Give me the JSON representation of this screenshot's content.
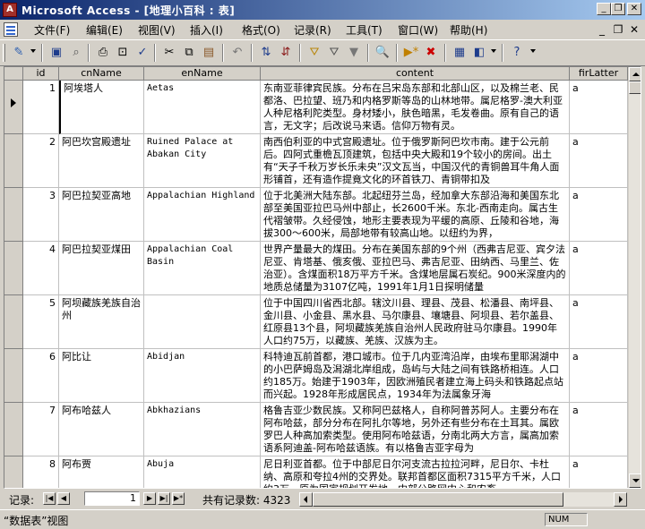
{
  "window": {
    "title": "Microsoft Access - [地理小百科 : 表]",
    "app_icon": "access-key-icon"
  },
  "menu": [
    "文件(F)",
    "编辑(E)",
    "视图(V)",
    "插入(I)",
    "格式(O)",
    "记录(R)",
    "工具(T)",
    "窗口(W)",
    "帮助(H)"
  ],
  "mdi_controls": [
    "minimize",
    "restore",
    "close"
  ],
  "toolbar_icons": [
    "view-icon",
    "save-icon",
    "search-db-icon",
    "print-icon",
    "print-preview-icon",
    "spelling-icon",
    "cut-icon",
    "copy-icon",
    "paste-icon",
    "undo-icon",
    "sort-asc-icon",
    "sort-desc-icon",
    "filter-selection-icon",
    "filter-form-icon",
    "apply-filter-icon",
    "find-icon",
    "new-record-icon",
    "delete-record-icon",
    "database-window-icon",
    "new-object-icon",
    "help-icon"
  ],
  "table": {
    "columns": [
      "id",
      "cnName",
      "enName",
      "content",
      "firLatter"
    ],
    "rows": [
      {
        "id": "1",
        "cnName": "阿埃塔人",
        "enName": "Aetas",
        "content": "东南亚菲律宾民族。分布在吕宋岛东部和北部山区，以及棉兰老、民都洛、巴拉望、班乃和内格罗斯等岛的山林地带。属尼格罗-澳大利亚人种尼格利陀类型。身材矮小，肤色暗黑，毛发卷曲。原有自己的语言，无文字；后改说马来语。信仰万物有灵。",
        "firLatter": "a"
      },
      {
        "id": "2",
        "cnName": "阿巴坎宫殿遗址",
        "enName": "Ruined Palace at Abakan City",
        "content": "南西伯利亚的中式宫殿遗址。位于俄罗斯阿巴坎市南。建于公元前后。四阿式重檐瓦顶建筑，包括中央大殿和19个较小的房间。出土有“天子千秋万岁长乐未央”汉文瓦当，中国汉代的青铜兽耳牛角人面形铺首，还有造作提竟文化的环首铁刀、青铜带扣及",
        "firLatter": "a"
      },
      {
        "id": "3",
        "cnName": "阿巴拉契亚高地",
        "enName": "Appalachian Highland",
        "content": "位于北美洲大陆东部。北起纽芬兰岛，经加拿大东部沿海和美国东北部至美国亚拉巴马州中部止，长2600千米。东北-西南走向。属古生代褶皱带。久经侵蚀，地形主要表现为平缓的高原、丘陵和谷地，海拔300～600米，局部地带有较高山地。以纽约为界，",
        "firLatter": "a"
      },
      {
        "id": "4",
        "cnName": "阿巴拉契亚煤田",
        "enName": "Appalachian Coal Basin",
        "content": "世界产量最大的煤田。分布在美国东部的9个州（西弗吉尼亚、宾夕法尼亚、肯塔基、俄亥俄、亚拉巴马、弗吉尼亚、田纳西、马里兰、佐治亚）。含煤面积18万平方千米。含煤地层属石炭纪。900米深度内的地质总储量为3107亿吨，1991年1月1日探明储量",
        "firLatter": "a"
      },
      {
        "id": "5",
        "cnName": "阿坝藏族羌族自治州",
        "enName": "",
        "content": "位于中国四川省西北部。辖汶川县、理县、茂县、松潘县、南坪县、金川县、小金县、黑水县、马尔康县、壤塘县、阿坝县、若尔盖县、红原县13个县，阿坝藏族羌族自治州人民政府驻马尔康县。1990年人口约75万，以藏族、羌族、汉族为主。",
        "firLatter": "a"
      },
      {
        "id": "6",
        "cnName": "阿比让",
        "enName": "Abidjan",
        "content": "科特迪瓦前首都，港口城市。位于几内亚湾沿岸，由埃布里耶潟湖中的小巴萨姆岛及潟湖北岸组成，岛屿与大陆之间有铁路桥相连。人口约185万。始建于1903年，因欧洲殖民者建立海上码头和铁路起点站而兴起。1928年形成居民点，1934年为法属象牙海",
        "firLatter": "a"
      },
      {
        "id": "7",
        "cnName": "阿布哈兹人",
        "enName": "Abkhazians",
        "content": "格鲁吉亚少数民族。又称阿巴兹格人，自称阿普苏阿人。主要分布在阿布哈兹，部分分布在阿扎尔等地，另外还有些分布在土耳其。属欧罗巴人种高加索类型。使用阿布哈兹语，分南北两大方言，属高加索语系阿迪盖-阿布哈兹语族。有以格鲁吉亚字母为",
        "firLatter": "a"
      },
      {
        "id": "8",
        "cnName": "阿布贾",
        "enName": "Abuja",
        "content": "尼日利亚首都。位于中部尼日尔河支流古拉拉河畔，尼日尔、卡杜纳、高原和夸拉4州的交界处。联邦首都区面积7315平方千米，人口约3万。原为国家规划开发地，中部公路网中心和农畜",
        "firLatter": "a"
      }
    ]
  },
  "navigation": {
    "label": "记录:",
    "current": "1",
    "total_label": "共有记录数: 4323",
    "buttons": [
      "first",
      "prev",
      "next",
      "last",
      "new"
    ]
  },
  "status": {
    "text": "“数据表”视图",
    "num": "NUM"
  }
}
